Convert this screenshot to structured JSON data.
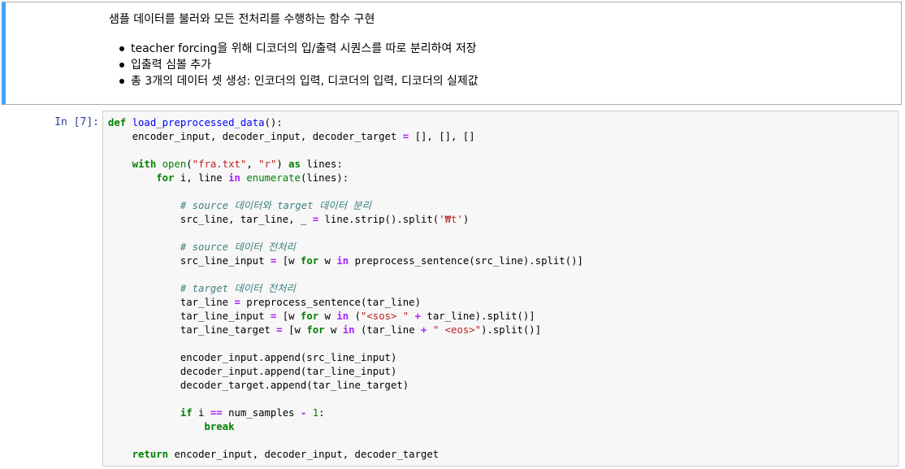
{
  "markdown": {
    "title": "샘플 데이터를 불러와 모든 전처리를 수행하는 함수 구현",
    "bullets": [
      "teacher forcing을 위해 디코더의 입/출력 시퀀스를 따로 분리하여 저장",
      "입출력 심볼 추가",
      "총 3개의 데이터 셋 생성: 인코더의 입력, 디코더의 입력, 디코더의 실제값"
    ]
  },
  "code_cell": {
    "prompt": "In [7]:",
    "lines": [
      [
        [
          "kw",
          "def"
        ],
        [
          "t",
          " "
        ],
        [
          "fn",
          "load_preprocessed_data"
        ],
        [
          "t",
          "():"
        ]
      ],
      [
        [
          "t",
          "    encoder_input, decoder_input, decoder_target "
        ],
        [
          "op",
          "="
        ],
        [
          "t",
          " [], [], []"
        ]
      ],
      [],
      [
        [
          "t",
          "    "
        ],
        [
          "kw",
          "with"
        ],
        [
          "t",
          " "
        ],
        [
          "bi",
          "open"
        ],
        [
          "t",
          "("
        ],
        [
          "str",
          "\"fra.txt\""
        ],
        [
          "t",
          ", "
        ],
        [
          "str",
          "\"r\""
        ],
        [
          "t",
          ") "
        ],
        [
          "kw",
          "as"
        ],
        [
          "t",
          " lines:"
        ]
      ],
      [
        [
          "t",
          "        "
        ],
        [
          "kw",
          "for"
        ],
        [
          "t",
          " i, line "
        ],
        [
          "op",
          "in"
        ],
        [
          "t",
          " "
        ],
        [
          "bi",
          "enumerate"
        ],
        [
          "t",
          "(lines):"
        ]
      ],
      [],
      [
        [
          "t",
          "            "
        ],
        [
          "cm",
          "# source 데이터와 target 데이터 분리"
        ]
      ],
      [
        [
          "t",
          "            src_line, tar_line, _ "
        ],
        [
          "op",
          "="
        ],
        [
          "t",
          " line.strip().split("
        ],
        [
          "str",
          "'₩t'"
        ],
        [
          "t",
          ")"
        ]
      ],
      [],
      [
        [
          "t",
          "            "
        ],
        [
          "cm",
          "# source 데이터 전처리"
        ]
      ],
      [
        [
          "t",
          "            src_line_input "
        ],
        [
          "op",
          "="
        ],
        [
          "t",
          " [w "
        ],
        [
          "kw",
          "for"
        ],
        [
          "t",
          " w "
        ],
        [
          "op",
          "in"
        ],
        [
          "t",
          " preprocess_sentence(src_line).split()]"
        ]
      ],
      [],
      [
        [
          "t",
          "            "
        ],
        [
          "cm",
          "# target 데이터 전처리"
        ]
      ],
      [
        [
          "t",
          "            tar_line "
        ],
        [
          "op",
          "="
        ],
        [
          "t",
          " preprocess_sentence(tar_line)"
        ]
      ],
      [
        [
          "t",
          "            tar_line_input "
        ],
        [
          "op",
          "="
        ],
        [
          "t",
          " [w "
        ],
        [
          "kw",
          "for"
        ],
        [
          "t",
          " w "
        ],
        [
          "op",
          "in"
        ],
        [
          "t",
          " ("
        ],
        [
          "str",
          "\"<sos> \""
        ],
        [
          "t",
          " "
        ],
        [
          "op",
          "+"
        ],
        [
          "t",
          " tar_line).split()]"
        ]
      ],
      [
        [
          "t",
          "            tar_line_target "
        ],
        [
          "op",
          "="
        ],
        [
          "t",
          " [w "
        ],
        [
          "kw",
          "for"
        ],
        [
          "t",
          " w "
        ],
        [
          "op",
          "in"
        ],
        [
          "t",
          " (tar_line "
        ],
        [
          "op",
          "+"
        ],
        [
          "t",
          " "
        ],
        [
          "str",
          "\" <eos>\""
        ],
        [
          "t",
          ").split()]"
        ]
      ],
      [],
      [
        [
          "t",
          "            encoder_input.append(src_line_input)"
        ]
      ],
      [
        [
          "t",
          "            decoder_input.append(tar_line_input)"
        ]
      ],
      [
        [
          "t",
          "            decoder_target.append(tar_line_target)"
        ]
      ],
      [],
      [
        [
          "t",
          "            "
        ],
        [
          "kw",
          "if"
        ],
        [
          "t",
          " i "
        ],
        [
          "op",
          "=="
        ],
        [
          "t",
          " num_samples "
        ],
        [
          "op",
          "-"
        ],
        [
          "t",
          " "
        ],
        [
          "num",
          "1"
        ],
        [
          "t",
          ":"
        ]
      ],
      [
        [
          "t",
          "                "
        ],
        [
          "kw",
          "break"
        ]
      ],
      [],
      [
        [
          "t",
          "    "
        ],
        [
          "kw",
          "return"
        ],
        [
          "t",
          " encoder_input, decoder_input, decoder_target"
        ]
      ]
    ]
  }
}
